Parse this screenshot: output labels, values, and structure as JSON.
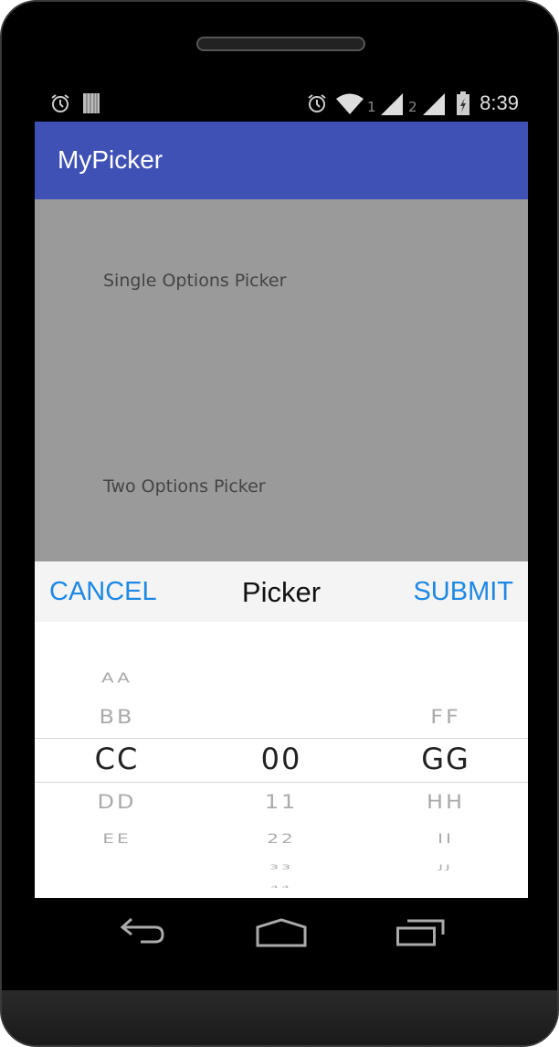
{
  "status_bar": {
    "time": "8:39",
    "sim1": "1",
    "sim2": "2",
    "icons": [
      "alarm-icon",
      "barcode-icon",
      "alarm-icon",
      "wifi-icon",
      "signal-icon",
      "signal-icon",
      "battery-charging-icon"
    ]
  },
  "app_bar": {
    "title": "MyPicker",
    "color": "#3F51B5"
  },
  "content": {
    "single_label": "Single Options Picker",
    "two_label": "Two Options Picker"
  },
  "picker": {
    "cancel_label": "CANCEL",
    "title": "Picker",
    "submit_label": "SUBMIT",
    "accent": "#1E88E5",
    "columns": [
      {
        "items": [
          "AA",
          "BB",
          "CC",
          "DD",
          "EE"
        ],
        "selected": "CC",
        "selected_index": 2
      },
      {
        "items": [
          "00",
          "11",
          "22",
          "33",
          "44"
        ],
        "selected": "00",
        "selected_index": 0
      },
      {
        "items": [
          "FF",
          "GG",
          "HH",
          "II",
          "JJ"
        ],
        "selected": "GG",
        "selected_index": 1
      }
    ]
  },
  "nav_bar": {
    "buttons": [
      "back-icon",
      "home-icon",
      "recents-icon"
    ]
  }
}
